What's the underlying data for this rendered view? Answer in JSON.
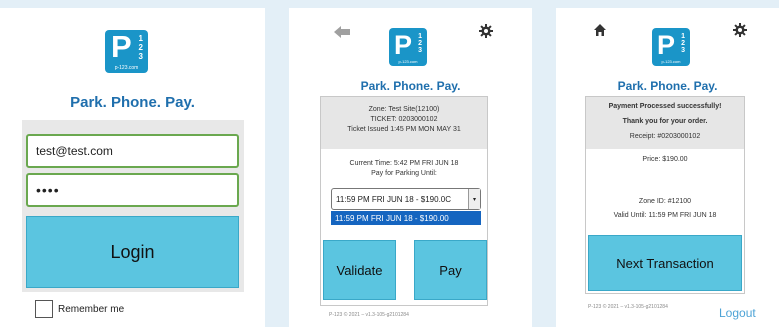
{
  "colors": {
    "brand": "#1a95c8",
    "tagline": "#1f6fad",
    "button": "#5bc5e0",
    "field_border": "#6aa84f",
    "dropdown_selected": "#1565c0"
  },
  "logo": {
    "letter": "P",
    "digits": [
      "1",
      "2",
      "3"
    ],
    "url": "p-123.com"
  },
  "tagline": "Park.  Phone.  Pay.",
  "login": {
    "email_value": "test@test.com",
    "password_value": "••••",
    "login_label": "Login",
    "remember_label": "Remember me"
  },
  "pay": {
    "back_icon": "back-arrow-icon",
    "settings_icon": "gear-icon",
    "zone": "Zone: Test Site(12100)",
    "ticket": "TICKET: 0203000102",
    "issued": "Ticket Issued 1:45 PM MON MAY 31",
    "current_time": "Current Time: 5:42 PM FRI JUN 18",
    "pay_until": "Pay for Parking Until:",
    "select_value": "11:59 PM FRI JUN 18 - $190.0C",
    "option_selected": "11:59 PM FRI JUN 18 - $190.00",
    "validate_label": "Validate",
    "pay_label": "Pay",
    "footer": "P-123 © 2021 – v1.3-105-g2101284"
  },
  "receipt": {
    "home_icon": "home-icon",
    "settings_icon": "gear-icon",
    "success": "Payment Processed successfully!",
    "thanks": "Thank you for your order.",
    "receipt_no": "Receipt: #0203000102",
    "price": "Price: $190.00",
    "zone_id": "Zone ID: #12100",
    "valid_until": "Valid Until: 11:59 PM FRI JUN 18",
    "next_label": "Next Transaction",
    "footer": "P-123 © 2021 – v1.3-105-g2101284",
    "logout_label": "Logout"
  }
}
